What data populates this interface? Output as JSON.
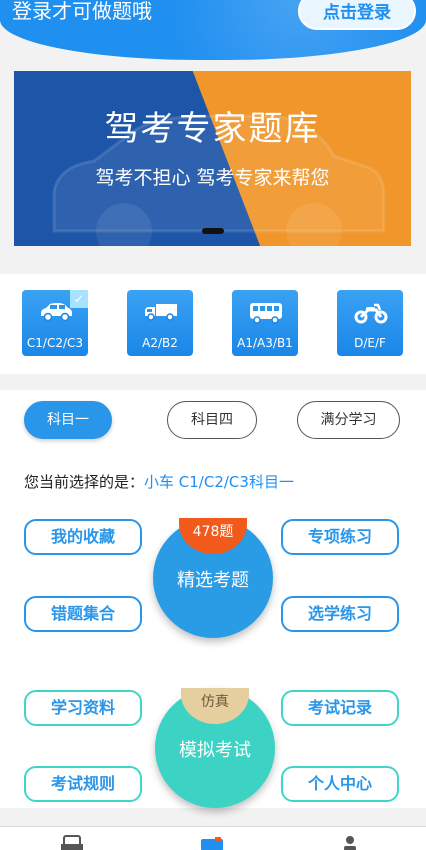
{
  "header": {
    "login_prompt": "登录才可做题哦",
    "login_button": "点击登录"
  },
  "banner": {
    "title": "驾考专家题库",
    "subtitle": "驾考不担心 驾考专家来帮您"
  },
  "vehicles": [
    {
      "label": "C1/C2/C3",
      "icon": "car-icon",
      "selected": true
    },
    {
      "label": "A2/B2",
      "icon": "truck-icon",
      "selected": false
    },
    {
      "label": "A1/A3/B1",
      "icon": "bus-icon",
      "selected": false
    },
    {
      "label": "D/E/F",
      "icon": "motorcycle-icon",
      "selected": false
    }
  ],
  "tabs": [
    {
      "label": "科目一",
      "active": true
    },
    {
      "label": "科目四",
      "active": false
    },
    {
      "label": "满分学习",
      "active": false
    }
  ],
  "current_selection": {
    "prefix": "您当前选择的是：",
    "value": "小车 C1/C2/C3科目一"
  },
  "practice": {
    "badge": "478题",
    "center": "精选考题",
    "favorites": "我的收藏",
    "wrong": "错题集合",
    "special": "专项练习",
    "select": "选学练习"
  },
  "exam": {
    "badge": "仿真",
    "center": "模拟考试",
    "materials": "学习资料",
    "rules": "考试规则",
    "records": "考试记录",
    "profile": "个人中心"
  },
  "colors": {
    "primary": "#1f8ff0",
    "teal": "#3cd3c4",
    "orange": "#f15a1a",
    "banner_blue": "#1d55a8",
    "banner_orange": "#f0962a"
  }
}
